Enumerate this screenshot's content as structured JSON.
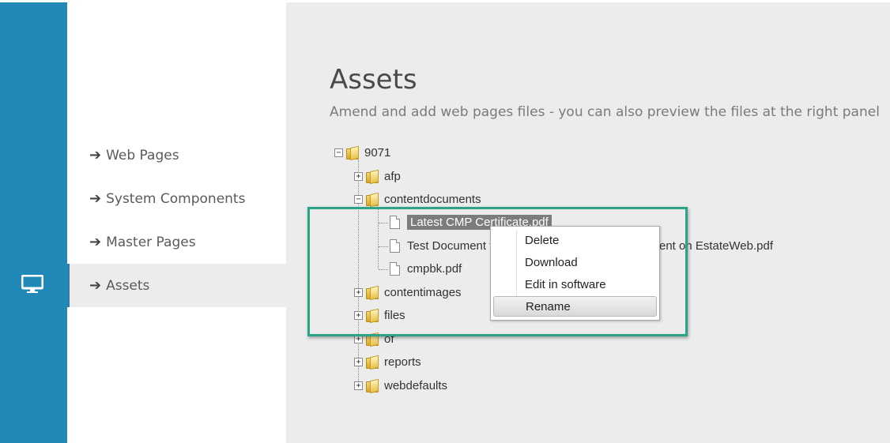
{
  "sidebar": {
    "items": [
      {
        "label": "Web Pages"
      },
      {
        "label": "System Components"
      },
      {
        "label": "Master Pages"
      },
      {
        "label": "Assets",
        "active": true
      }
    ]
  },
  "main": {
    "title": "Assets",
    "subtitle": "Amend and add web pages files - you can also preview the files at the right panel"
  },
  "tree": {
    "root": "9071",
    "afp": "afp",
    "contentdocuments": "contentdocuments",
    "file1": "Latest CMP Certificate.pdf",
    "file2_start": "Test Document f",
    "file2_end": "ent on EstateWeb.pdf",
    "file3": "cmpbk.pdf",
    "contentimages": "contentimages",
    "files": "files",
    "of": "of",
    "reports": "reports",
    "webdefaults": "webdefaults"
  },
  "context_menu": {
    "items": [
      "Delete",
      "Download",
      "Edit in software",
      "Rename"
    ],
    "hovered": "Rename"
  },
  "colors": {
    "rail": "#2089b8",
    "highlight": "#2aa386",
    "selected": "#7c7c7c"
  }
}
